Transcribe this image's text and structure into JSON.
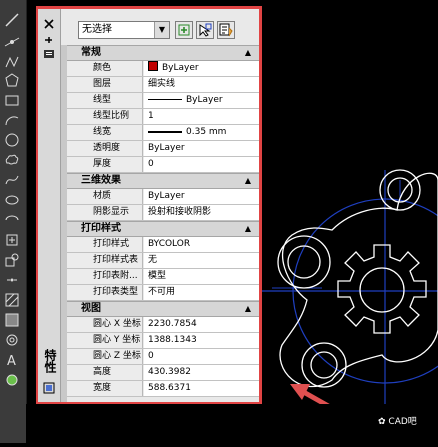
{
  "palette": {
    "title": "特性"
  },
  "selection": {
    "value": "无选择"
  },
  "sections": {
    "general": {
      "title": "常规",
      "collapse": "▲"
    },
    "3d": {
      "title": "三维效果",
      "collapse": "▲"
    },
    "print": {
      "title": "打印样式",
      "collapse": "▲"
    },
    "view": {
      "title": "视图",
      "collapse": "▲"
    }
  },
  "general": [
    {
      "label": "颜色",
      "value": "ByLayer"
    },
    {
      "label": "图层",
      "value": "细实线"
    },
    {
      "label": "线型",
      "value": "ByLayer"
    },
    {
      "label": "线型比例",
      "value": "1"
    },
    {
      "label": "线宽",
      "value": "0.35 mm"
    },
    {
      "label": "透明度",
      "value": "ByLayer"
    },
    {
      "label": "厚度",
      "value": "0"
    }
  ],
  "effects3d": [
    {
      "label": "材质",
      "value": "ByLayer"
    },
    {
      "label": "阴影显示",
      "value": "投射和接收阴影"
    }
  ],
  "printstyle": [
    {
      "label": "打印样式",
      "value": "BYCOLOR"
    },
    {
      "label": "打印样式表",
      "value": "无"
    },
    {
      "label": "打印表附...",
      "value": "模型"
    },
    {
      "label": "打印表类型",
      "value": "不可用"
    }
  ],
  "view": [
    {
      "label": "圆心 X 坐标",
      "value": "2230.7854"
    },
    {
      "label": "圆心 Y 坐标",
      "value": "1388.1343"
    },
    {
      "label": "圆心 Z 坐标",
      "value": "0"
    },
    {
      "label": "高度",
      "value": "430.3982"
    },
    {
      "label": "宽度",
      "value": "588.6371"
    }
  ],
  "watermark": {
    "text": "CAD吧"
  },
  "colors": {
    "highlight": "#e14444",
    "accent": "#1f3fbf"
  }
}
